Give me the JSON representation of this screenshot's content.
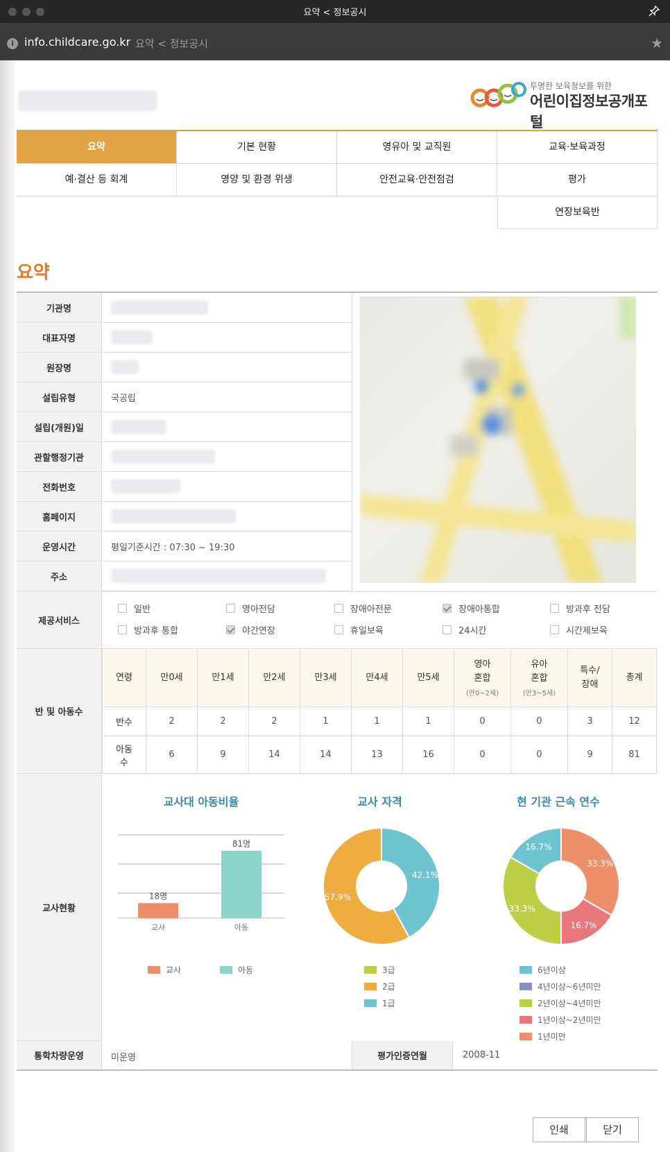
{
  "window": {
    "title": "요약 < 정보공시"
  },
  "urlbar": {
    "host": "info.childcare.go.kr",
    "page_title": "요약 < 정보공시"
  },
  "logo": {
    "sub": "투명한 보육정보를 위한",
    "main": "어린이집정보공개포털"
  },
  "nav": {
    "items": [
      "요약",
      "기본 현황",
      "영유아 및 교직원",
      "교육·보육과정",
      "예·결산 등 회계",
      "영양 및 환경 위생",
      "안전교육·안전점검",
      "평가",
      "연장보육반"
    ]
  },
  "section_title": "요약",
  "summary": {
    "rows": [
      {
        "label": "기관명",
        "value": ""
      },
      {
        "label": "대표자명",
        "value": ""
      },
      {
        "label": "원장명",
        "value": ""
      },
      {
        "label": "설립유형",
        "value": "국공립"
      },
      {
        "label": "설립(개원)일",
        "value": ""
      },
      {
        "label": "관할행정기관",
        "value": ""
      },
      {
        "label": "전화번호",
        "value": ""
      },
      {
        "label": "홈페이지",
        "value": ""
      },
      {
        "label": "운영시간",
        "value": "평일기준시간 : 07:30 ~ 19:30"
      },
      {
        "label": "주소",
        "value": ""
      }
    ]
  },
  "services": {
    "label": "제공서비스",
    "items": [
      {
        "name": "일반",
        "checked": false
      },
      {
        "name": "영아전담",
        "checked": false
      },
      {
        "name": "장애아전문",
        "checked": false
      },
      {
        "name": "장애아통합",
        "checked": true
      },
      {
        "name": "방과후 전담",
        "checked": false
      },
      {
        "name": "방과후 통합",
        "checked": false
      },
      {
        "name": "야간연장",
        "checked": true
      },
      {
        "name": "휴일보육",
        "checked": false
      },
      {
        "name": "24시간",
        "checked": false
      },
      {
        "name": "시간제보육",
        "checked": false
      }
    ]
  },
  "classes": {
    "label": "반 및 아동수",
    "headers": [
      {
        "main": "연령",
        "sub": ""
      },
      {
        "main": "만0세",
        "sub": ""
      },
      {
        "main": "만1세",
        "sub": ""
      },
      {
        "main": "만2세",
        "sub": ""
      },
      {
        "main": "만3세",
        "sub": ""
      },
      {
        "main": "만4세",
        "sub": ""
      },
      {
        "main": "만5세",
        "sub": ""
      },
      {
        "main": "영아\n혼합",
        "sub": "(만0~2세)"
      },
      {
        "main": "유아\n혼합",
        "sub": "(만3~5세)"
      },
      {
        "main": "특수/\n장애",
        "sub": ""
      },
      {
        "main": "총계",
        "sub": ""
      }
    ],
    "rows": [
      {
        "label": "반수",
        "values": [
          "2",
          "2",
          "2",
          "1",
          "1",
          "1",
          "0",
          "0",
          "3",
          "12"
        ]
      },
      {
        "label": "아동\n수",
        "values": [
          "6",
          "9",
          "14",
          "14",
          "13",
          "16",
          "0",
          "0",
          "9",
          "81"
        ]
      }
    ]
  },
  "teachers": {
    "label": "교사현황",
    "ratio_title": "교사대 아동비율",
    "qual_title": "교사 자격",
    "tenure_title": "현 기관 근속 연수"
  },
  "chart_data": [
    {
      "type": "bar",
      "title": "교사대 아동비율",
      "categories": [
        "교사",
        "아동"
      ],
      "values": [
        18,
        81
      ],
      "value_labels": [
        "18명",
        "81명"
      ],
      "colors": [
        "#ec8f6a",
        "#8dd5c9"
      ],
      "legend": [
        "교사",
        "아동"
      ],
      "grid": true
    },
    {
      "type": "pie",
      "title": "교사 자격",
      "labels": [
        "1급",
        "2급",
        "3급"
      ],
      "values": [
        42.1,
        57.9,
        0
      ],
      "value_labels": [
        "42.1%",
        "57.9%",
        ""
      ],
      "colors": [
        "#6dc4d0",
        "#f0ad3f",
        "#bccf45"
      ],
      "legend": [
        "3급",
        "2급",
        "1급"
      ],
      "legend_colors": [
        "#bccf45",
        "#f0ad3f",
        "#6dc4d0"
      ]
    },
    {
      "type": "pie",
      "title": "현 기관 근속 연수",
      "labels": [
        "1년미만",
        "1년이상~2년미만",
        "2년이상~4년미만",
        "4년이상~6년미만",
        "6년이상"
      ],
      "values": [
        33.3,
        16.7,
        33.3,
        0,
        16.7
      ],
      "value_labels": [
        "33.3%",
        "16.7%",
        "33.3%",
        "",
        "16.7%"
      ],
      "colors": [
        "#ec8f6a",
        "#e8787c",
        "#bccf45",
        "#8c90c0",
        "#6dc4d0"
      ],
      "legend": [
        "6년이상",
        "4년이상~6년미만",
        "2년이상~4년미만",
        "1년이상~2년미만",
        "1년미만"
      ],
      "legend_colors": [
        "#6dc4d0",
        "#8c90c0",
        "#bccf45",
        "#e8787c",
        "#ec8f6a"
      ]
    }
  ],
  "bottom": {
    "vehicle_label": "통학차량운영",
    "vehicle_value": "미운영",
    "cert_label": "평가인증연월",
    "cert_value": "2008-11"
  },
  "buttons": {
    "print": "인쇄",
    "close": "닫기"
  }
}
